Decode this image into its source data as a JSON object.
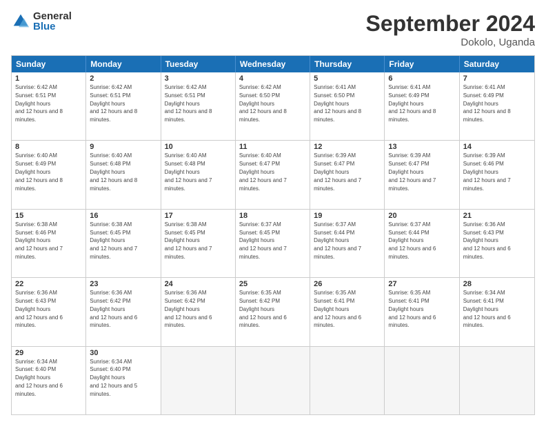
{
  "logo": {
    "general": "General",
    "blue": "Blue"
  },
  "title": "September 2024",
  "subtitle": "Dokolo, Uganda",
  "days": [
    "Sunday",
    "Monday",
    "Tuesday",
    "Wednesday",
    "Thursday",
    "Friday",
    "Saturday"
  ],
  "weeks": [
    [
      {
        "day": 1,
        "sunrise": "6:42 AM",
        "sunset": "6:51 PM",
        "daylight": "12 hours and 8 minutes."
      },
      {
        "day": 2,
        "sunrise": "6:42 AM",
        "sunset": "6:51 PM",
        "daylight": "12 hours and 8 minutes."
      },
      {
        "day": 3,
        "sunrise": "6:42 AM",
        "sunset": "6:51 PM",
        "daylight": "12 hours and 8 minutes."
      },
      {
        "day": 4,
        "sunrise": "6:42 AM",
        "sunset": "6:50 PM",
        "daylight": "12 hours and 8 minutes."
      },
      {
        "day": 5,
        "sunrise": "6:41 AM",
        "sunset": "6:50 PM",
        "daylight": "12 hours and 8 minutes."
      },
      {
        "day": 6,
        "sunrise": "6:41 AM",
        "sunset": "6:49 PM",
        "daylight": "12 hours and 8 minutes."
      },
      {
        "day": 7,
        "sunrise": "6:41 AM",
        "sunset": "6:49 PM",
        "daylight": "12 hours and 8 minutes."
      }
    ],
    [
      {
        "day": 8,
        "sunrise": "6:40 AM",
        "sunset": "6:49 PM",
        "daylight": "12 hours and 8 minutes."
      },
      {
        "day": 9,
        "sunrise": "6:40 AM",
        "sunset": "6:48 PM",
        "daylight": "12 hours and 8 minutes."
      },
      {
        "day": 10,
        "sunrise": "6:40 AM",
        "sunset": "6:48 PM",
        "daylight": "12 hours and 7 minutes."
      },
      {
        "day": 11,
        "sunrise": "6:40 AM",
        "sunset": "6:47 PM",
        "daylight": "12 hours and 7 minutes."
      },
      {
        "day": 12,
        "sunrise": "6:39 AM",
        "sunset": "6:47 PM",
        "daylight": "12 hours and 7 minutes."
      },
      {
        "day": 13,
        "sunrise": "6:39 AM",
        "sunset": "6:47 PM",
        "daylight": "12 hours and 7 minutes."
      },
      {
        "day": 14,
        "sunrise": "6:39 AM",
        "sunset": "6:46 PM",
        "daylight": "12 hours and 7 minutes."
      }
    ],
    [
      {
        "day": 15,
        "sunrise": "6:38 AM",
        "sunset": "6:46 PM",
        "daylight": "12 hours and 7 minutes."
      },
      {
        "day": 16,
        "sunrise": "6:38 AM",
        "sunset": "6:45 PM",
        "daylight": "12 hours and 7 minutes."
      },
      {
        "day": 17,
        "sunrise": "6:38 AM",
        "sunset": "6:45 PM",
        "daylight": "12 hours and 7 minutes."
      },
      {
        "day": 18,
        "sunrise": "6:37 AM",
        "sunset": "6:45 PM",
        "daylight": "12 hours and 7 minutes."
      },
      {
        "day": 19,
        "sunrise": "6:37 AM",
        "sunset": "6:44 PM",
        "daylight": "12 hours and 7 minutes."
      },
      {
        "day": 20,
        "sunrise": "6:37 AM",
        "sunset": "6:44 PM",
        "daylight": "12 hours and 6 minutes."
      },
      {
        "day": 21,
        "sunrise": "6:36 AM",
        "sunset": "6:43 PM",
        "daylight": "12 hours and 6 minutes."
      }
    ],
    [
      {
        "day": 22,
        "sunrise": "6:36 AM",
        "sunset": "6:43 PM",
        "daylight": "12 hours and 6 minutes."
      },
      {
        "day": 23,
        "sunrise": "6:36 AM",
        "sunset": "6:42 PM",
        "daylight": "12 hours and 6 minutes."
      },
      {
        "day": 24,
        "sunrise": "6:36 AM",
        "sunset": "6:42 PM",
        "daylight": "12 hours and 6 minutes."
      },
      {
        "day": 25,
        "sunrise": "6:35 AM",
        "sunset": "6:42 PM",
        "daylight": "12 hours and 6 minutes."
      },
      {
        "day": 26,
        "sunrise": "6:35 AM",
        "sunset": "6:41 PM",
        "daylight": "12 hours and 6 minutes."
      },
      {
        "day": 27,
        "sunrise": "6:35 AM",
        "sunset": "6:41 PM",
        "daylight": "12 hours and 6 minutes."
      },
      {
        "day": 28,
        "sunrise": "6:34 AM",
        "sunset": "6:41 PM",
        "daylight": "12 hours and 6 minutes."
      }
    ],
    [
      {
        "day": 29,
        "sunrise": "6:34 AM",
        "sunset": "6:40 PM",
        "daylight": "12 hours and 6 minutes."
      },
      {
        "day": 30,
        "sunrise": "6:34 AM",
        "sunset": "6:40 PM",
        "daylight": "12 hours and 5 minutes."
      },
      null,
      null,
      null,
      null,
      null
    ]
  ]
}
